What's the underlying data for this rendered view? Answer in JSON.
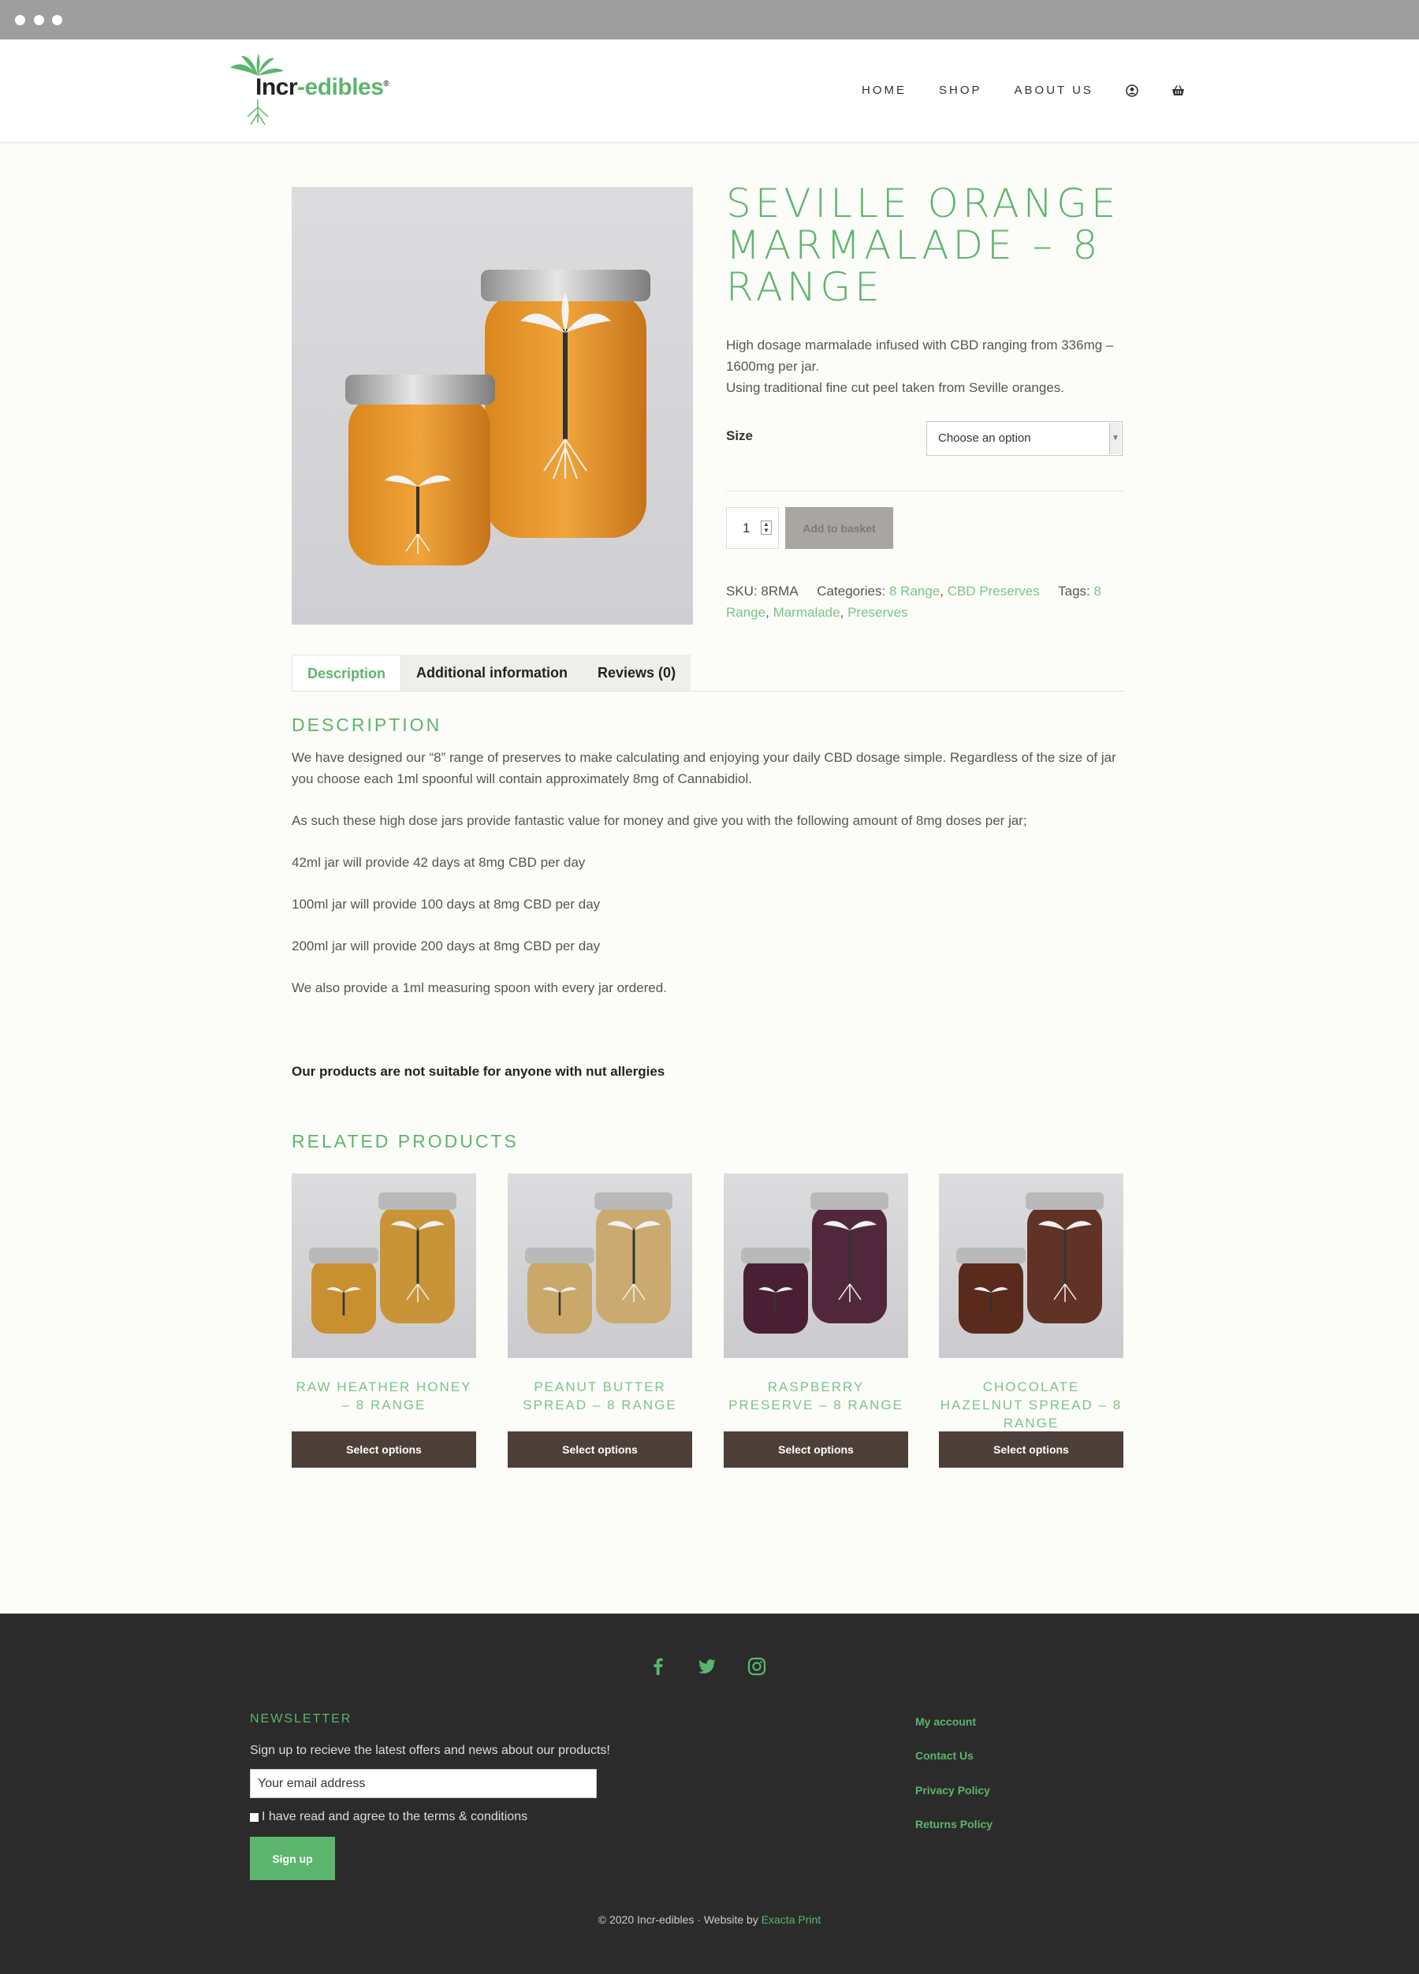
{
  "header": {
    "logo_part1": "Incr",
    "logo_part2": "-edibles",
    "logo_mark": "®",
    "nav": [
      {
        "label": "HOME"
      },
      {
        "label": "SHOP"
      },
      {
        "label": "ABOUT US"
      }
    ],
    "icons": [
      "account-icon",
      "basket-icon"
    ]
  },
  "product": {
    "title": "SEVILLE ORANGE MARMALADE – 8 RANGE",
    "short_desc_1": "High dosage marmalade infused with CBD ranging from 336mg – 1600mg per jar.",
    "short_desc_2": "Using traditional fine cut peel taken from Seville oranges.",
    "size_label": "Size",
    "size_value": "Choose an option",
    "quantity": "1",
    "add_to_basket": "Add to basket",
    "sku_label": "SKU:",
    "sku": "8RMA",
    "categories_label": "Categories:",
    "categories": [
      "8 Range",
      "CBD Preserves"
    ],
    "tags_label": "Tags:",
    "tags": [
      "8 Range",
      "Marmalade",
      "Preserves"
    ]
  },
  "tabs": [
    {
      "label": "Description",
      "active": true
    },
    {
      "label": "Additional information",
      "active": false
    },
    {
      "label": "Reviews (0)",
      "active": false
    }
  ],
  "description": {
    "heading": "DESCRIPTION",
    "paragraphs": [
      "We have designed our “8” range of preserves to make calculating and enjoying your daily CBD dosage simple. Regardless of the size of jar you choose each 1ml spoonful will contain approximately 8mg of Cannabidiol.",
      "As such these high dose jars provide fantastic value for money and give you with the following amount of 8mg doses per jar;",
      "42ml jar will provide 42 days at 8mg CBD per day",
      "100ml jar will provide 100 days at 8mg CBD per day",
      "200ml jar will provide 200 days at 8mg CBD per day",
      "We also provide a 1ml measuring spoon with every jar ordered."
    ],
    "warning": "Our products are not suitable for anyone with nut allergies"
  },
  "related": {
    "heading": "RELATED PRODUCTS",
    "button_label": "Select options",
    "items": [
      {
        "title": "RAW HEATHER HONEY – 8 RANGE",
        "color": "#c8902e"
      },
      {
        "title": "PEANUT BUTTER SPREAD – 8 RANGE",
        "color": "#c9a86a"
      },
      {
        "title": "RASPBERRY PRESERVE – 8 RANGE",
        "color": "#4a1f33"
      },
      {
        "title": "CHOCOLATE HAZELNUT SPREAD – 8 RANGE",
        "color": "#5a2a1c"
      }
    ]
  },
  "footer": {
    "social_icons": [
      "facebook-icon",
      "twitter-icon",
      "instagram-icon"
    ],
    "newsletter_title": "NEWSLETTER",
    "newsletter_text": "Sign up to recieve the latest offers and news about our products!",
    "email_placeholder": "Your email address",
    "agree_text": "I have read and agree to the terms & conditions",
    "signup_label": "Sign up",
    "links": [
      "My account",
      "Contact Us",
      "Privacy Policy",
      "Returns Policy"
    ],
    "copyright": "© 2020 Incr-edibles · Website by ",
    "credit": "Exacta Print"
  },
  "colors": {
    "accent": "#5cb56d",
    "button_dark": "#4e4039",
    "footer_bg": "#2b2b2b"
  }
}
